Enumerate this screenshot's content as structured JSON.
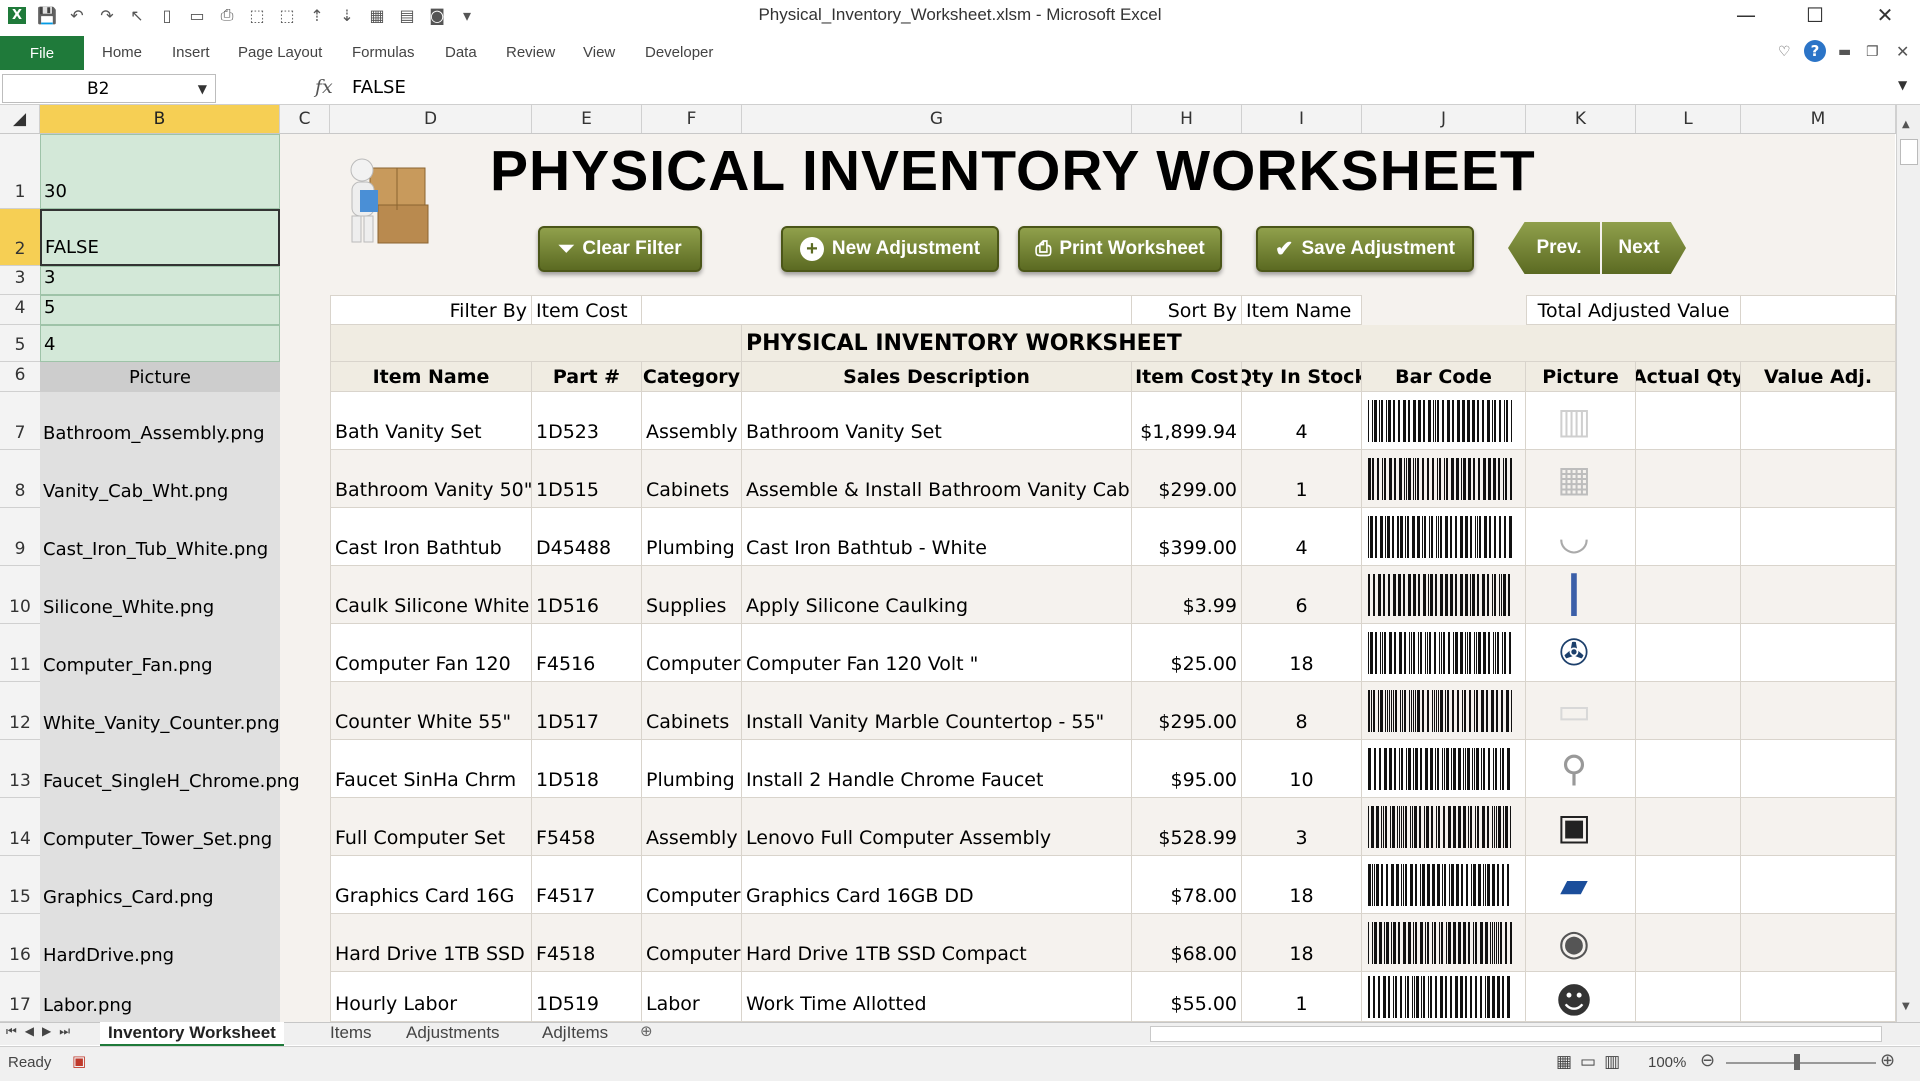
{
  "window": {
    "title": "Physical_Inventory_Worksheet.xlsm - Microsoft Excel",
    "minimize": "—",
    "maximize": "☐",
    "close": "✕"
  },
  "ribbon": {
    "file": "File",
    "tabs": [
      "Home",
      "Insert",
      "Page Layout",
      "Formulas",
      "Data",
      "Review",
      "View",
      "Developer"
    ]
  },
  "formula_bar": {
    "name_box": "B2",
    "fx": "fx",
    "value": "FALSE"
  },
  "columns": [
    "B",
    "C",
    "D",
    "E",
    "F",
    "G",
    "H",
    "I",
    "J",
    "K",
    "L",
    "M"
  ],
  "rows": [
    "1",
    "2",
    "3",
    "4",
    "5",
    "6",
    "7",
    "8",
    "9",
    "10",
    "11",
    "12",
    "13",
    "14",
    "15",
    "16",
    "17"
  ],
  "col_b": {
    "b1": "30",
    "b2": "FALSE",
    "b3": "3",
    "b4": "5",
    "b5": "4",
    "b6": "Picture"
  },
  "worksheet": {
    "title": "PHYSICAL INVENTORY WORKSHEET",
    "buttons": {
      "clear_filter": "Clear Filter",
      "new_adjustment": "New Adjustment",
      "print_worksheet": "Print Worksheet",
      "save_adjustment": "Save Adjustment",
      "prev": "Prev.",
      "next": "Next"
    },
    "filter_by_label": "Filter By",
    "filter_by_value": "Item Cost",
    "sort_by_label": "Sort By",
    "sort_by_value": "Item Name",
    "total_adjusted_value": "Total Adjusted Value",
    "table_title": "PHYSICAL INVENTORY WORKSHEET",
    "headers": [
      "Item Name",
      "Part #",
      "Category",
      "Sales Description",
      "Item Cost",
      "Qty In Stock",
      "Bar Code",
      "Picture",
      "Actual Qty",
      "Value Adj."
    ],
    "items": [
      {
        "file": "Bathroom_Assembly.png",
        "name": "Bath Vanity Set",
        "part": "1D523",
        "category": "Assembly",
        "desc": "Bathroom Vanity Set",
        "cost": "$1,899.94",
        "qty": "4",
        "icon": "vanity-icon"
      },
      {
        "file": "Vanity_Cab_Wht.png",
        "name": "Bathroom Vanity 50\"",
        "part": "1D515",
        "category": "Cabinets",
        "desc": "Assemble & Install Bathroom Vanity Cabin",
        "cost": "$299.00",
        "qty": "1",
        "icon": "cabinet-icon"
      },
      {
        "file": "Cast_Iron_Tub_White.png",
        "name": "Cast Iron Bathtub",
        "part": "D45488",
        "category": "Plumbing",
        "desc": "Cast Iron Bathtub - White",
        "cost": "$399.00",
        "qty": "4",
        "icon": "bathtub-icon"
      },
      {
        "file": "Silicone_White.png",
        "name": "Caulk Silicone White",
        "part": "1D516",
        "category": "Supplies",
        "desc": "Apply Silicone Caulking",
        "cost": "$3.99",
        "qty": "6",
        "icon": "caulk-tube-icon"
      },
      {
        "file": "Computer_Fan.png",
        "name": "Computer Fan 120",
        "part": "F4516",
        "category": "Computer",
        "desc": "Computer Fan 120 Volt \"",
        "cost": "$25.00",
        "qty": "18",
        "icon": "fan-icon"
      },
      {
        "file": "White_Vanity_Counter.png",
        "name": "Counter White 55\"",
        "part": "1D517",
        "category": "Cabinets",
        "desc": "Install Vanity Marble Countertop - 55\"",
        "cost": "$295.00",
        "qty": "8",
        "icon": "countertop-icon"
      },
      {
        "file": "Faucet_SingleH_Chrome.png",
        "name": "Faucet SinHa Chrm",
        "part": "1D518",
        "category": "Plumbing",
        "desc": "Install 2 Handle Chrome Faucet",
        "cost": "$95.00",
        "qty": "10",
        "icon": "faucet-icon"
      },
      {
        "file": "Computer_Tower_Set.png",
        "name": "Full Computer Set",
        "part": "F5458",
        "category": "Assembly",
        "desc": "Lenovo Full Computer Assembly",
        "cost": "$528.99",
        "qty": "3",
        "icon": "computer-icon"
      },
      {
        "file": "Graphics_Card.png",
        "name": "Graphics Card 16G",
        "part": "F4517",
        "category": "Computer",
        "desc": "Graphics Card 16GB DD",
        "cost": "$78.00",
        "qty": "18",
        "icon": "graphics-card-icon"
      },
      {
        "file": "HardDrive.png",
        "name": "Hard Drive 1TB SSD",
        "part": "F4518",
        "category": "Computer",
        "desc": "Hard Drive 1TB SSD Compact",
        "cost": "$68.00",
        "qty": "18",
        "icon": "hard-drive-icon"
      },
      {
        "file": "Labor.png",
        "name": "Hourly Labor",
        "part": "1D519",
        "category": "Labor",
        "desc": "Work Time Allotted",
        "cost": "$55.00",
        "qty": "1",
        "icon": "worker-icon"
      }
    ]
  },
  "sheet_tabs": [
    "Inventory Worksheet",
    "Items",
    "Adjustments",
    "AdjItems"
  ],
  "status": {
    "ready": "Ready",
    "zoom": "100%"
  },
  "colors": {
    "excel_green": "#1f7a3a",
    "button_olive": "#7a8a36",
    "selected_header": "#f6cf54",
    "cell_green": "#d3e8d8"
  }
}
